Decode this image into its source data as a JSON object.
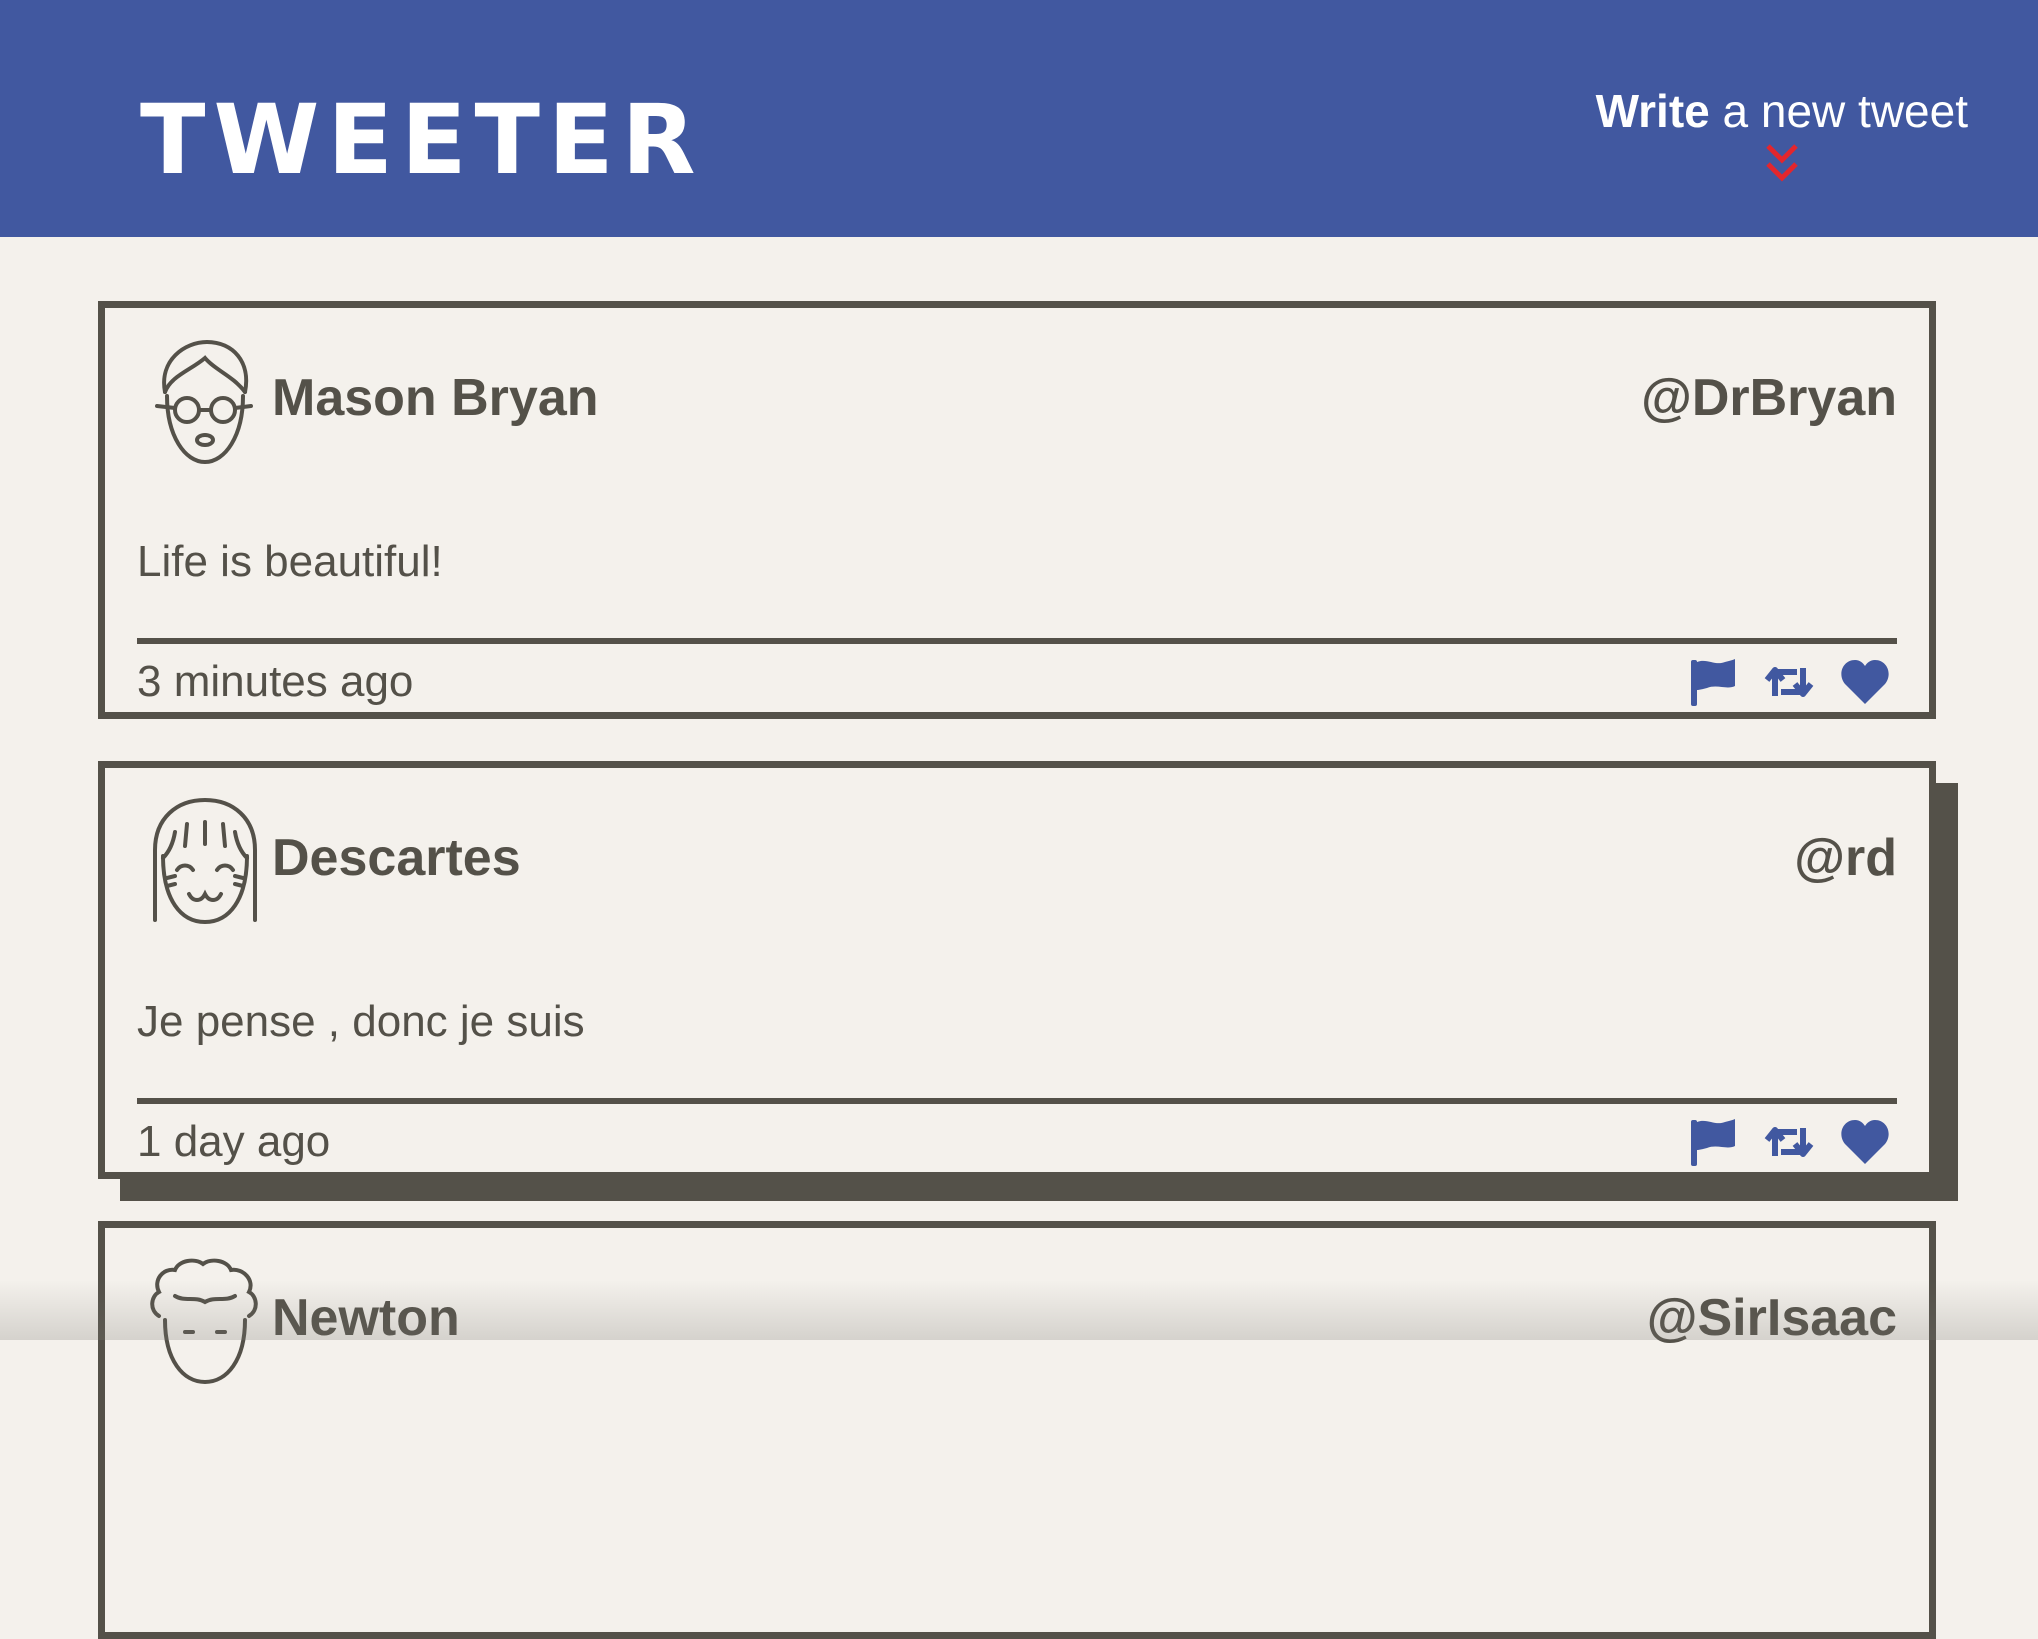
{
  "header": {
    "brand": "TWEETER",
    "compose_strong": "Write",
    "compose_rest": " a new tweet",
    "compose_icon": "double-chevron-down-icon",
    "compose_icon_color": "#e3262d"
  },
  "colors": {
    "nav_background": "#4158a0",
    "page_background": "#f4f1ec",
    "text_dark": "#545149",
    "icon_blue": "#4158a0"
  },
  "tweets": [
    {
      "name": "Mason Bryan",
      "handle": "@DrBryan",
      "body": "Life is beautiful!",
      "time": "3 minutes ago",
      "avatar": "glasses-person-icon"
    },
    {
      "name": "Descartes",
      "handle": "@rd",
      "body": "Je pense , donc je suis",
      "time": "1 day ago",
      "avatar": "bangs-person-icon"
    },
    {
      "name": "Newton",
      "handle": "@SirIsaac",
      "body": "",
      "time": "",
      "avatar": "curly-hair-person-icon"
    }
  ],
  "action_icons": [
    "flag-icon",
    "retweet-icon",
    "heart-icon"
  ]
}
